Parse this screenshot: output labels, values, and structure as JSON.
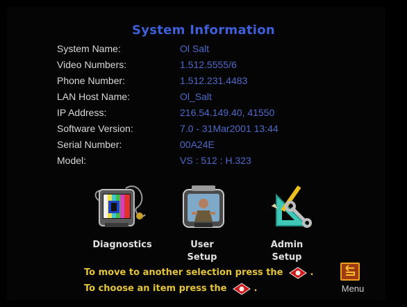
{
  "title": "System Information",
  "info": [
    {
      "label": "System Name:",
      "value": "Ol Salt"
    },
    {
      "label": "Video Numbers:",
      "value": "1.512.5555/6"
    },
    {
      "label": "Phone Number:",
      "value": "1.512.231.4483"
    },
    {
      "label": "LAN Host Name:",
      "value": "Ol_Salt"
    },
    {
      "label": "IP Address:",
      "value": "216.54.149.40, 41550"
    },
    {
      "label": "Software Version:",
      "value": "7.0 - 31Mar2001 13:44"
    },
    {
      "label": "Serial Number:",
      "value": "00A24E"
    },
    {
      "label": "Model:",
      "value": "VS : 512 : H.323"
    }
  ],
  "menu": [
    {
      "label": "Diagnostics",
      "icon": "tv-color-bars-icon"
    },
    {
      "label": "User\nSetup",
      "icon": "user-monitor-icon"
    },
    {
      "label": "Admin\nSetup",
      "icon": "tools-triangle-icon"
    }
  ],
  "instructions": {
    "move": "To move to another selection press the",
    "choose": "To choose an item press the"
  },
  "menu_button": {
    "label": "Menu",
    "icon": "return-arrow-icon"
  },
  "colors": {
    "title": "#3f5fd8",
    "value": "#4f69c9",
    "label": "#d8d8d8",
    "instruction": "#e3c43a",
    "background": "#000000"
  }
}
